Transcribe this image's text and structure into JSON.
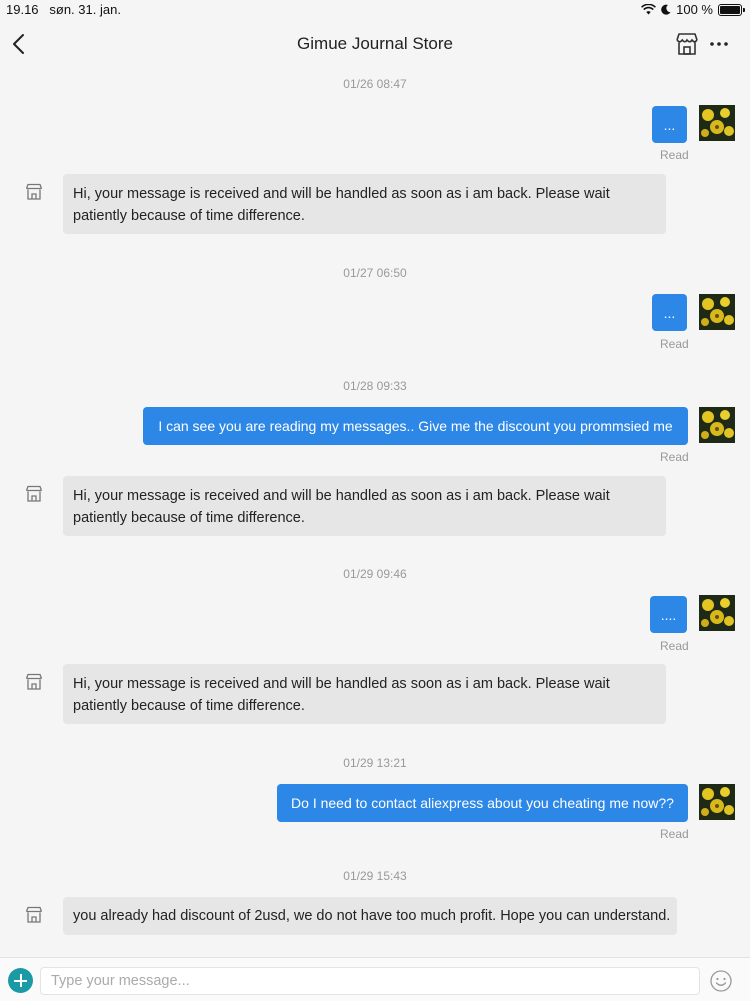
{
  "status_bar": {
    "time": "19.16",
    "date": "søn. 31. jan.",
    "battery": "100 %"
  },
  "header": {
    "title": "Gimue Journal Store",
    "back_icon": "chevron-left-icon",
    "store_icon": "store-icon",
    "more_icon": "more-horizontal-icon"
  },
  "chat": {
    "read_label": "Read",
    "timestamps": [
      "01/26 08:47",
      "01/27 06:50",
      "01/28 09:33",
      "01/29 09:46",
      "01/29 13:21",
      "01/29 15:43"
    ],
    "outgoing": [
      {
        "text": "..."
      },
      {
        "text": "..."
      },
      {
        "text": "I can see you are reading my messages.. Give me the discount you prommsied me"
      },
      {
        "text": "...."
      },
      {
        "text": "Do I need to contact aliexpress about you cheating me now??"
      }
    ],
    "incoming": [
      {
        "text": "Hi, your message is received and will be handled as soon as i am back. Please wait patiently because of time difference."
      },
      {
        "text": "Hi, your message is received and will be handled as soon as i am back. Please wait patiently because of time difference."
      },
      {
        "text": "Hi, your message is received and will be handled as soon as i am back. Please wait patiently because of time difference."
      },
      {
        "text": "you already had discount of 2usd, we do not have too much profit. Hope you can understand."
      }
    ]
  },
  "composer": {
    "placeholder": "Type your message...",
    "value": ""
  },
  "colors": {
    "outgoing_bubble": "#2c87e6",
    "incoming_bubble": "#e6e6e6",
    "plus_button": "#1b9aa6"
  }
}
